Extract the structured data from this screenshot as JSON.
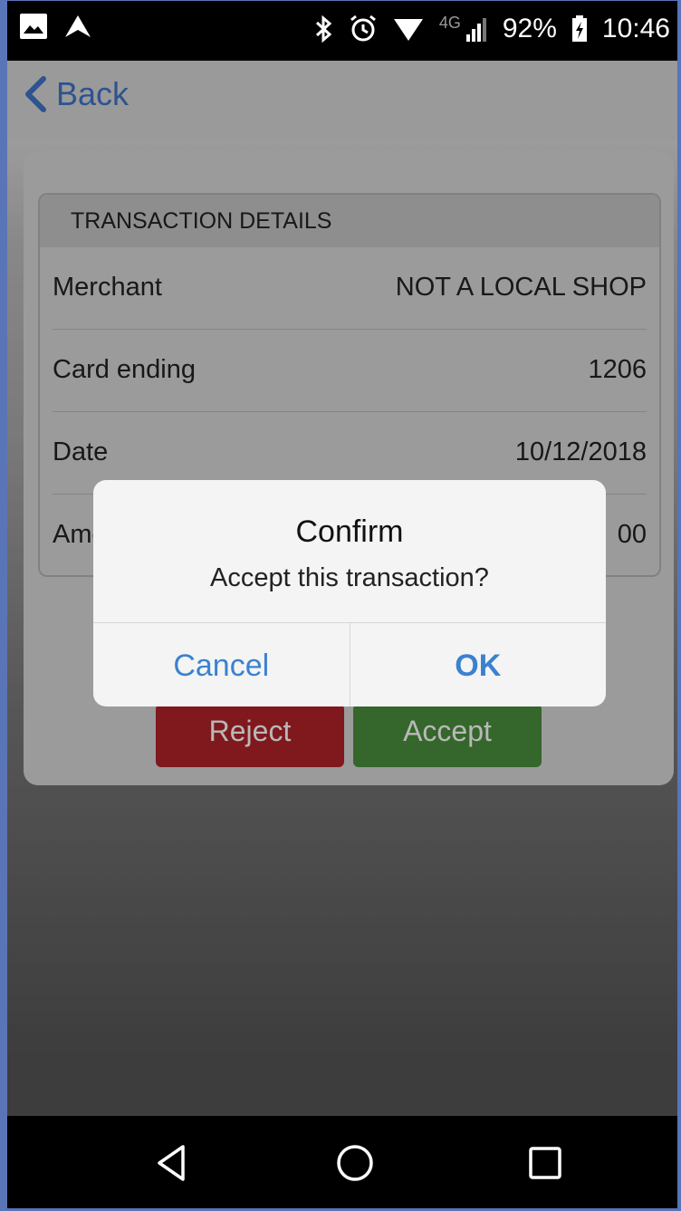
{
  "status_bar": {
    "battery": "92%",
    "time": "10:46",
    "network": "4G"
  },
  "header": {
    "back_label": "Back"
  },
  "details": {
    "title": "TRANSACTION DETAILS",
    "rows": [
      {
        "label": "Merchant",
        "value": "NOT A LOCAL SHOP"
      },
      {
        "label": "Card ending",
        "value": "1206"
      },
      {
        "label": "Date",
        "value": "10/12/2018"
      },
      {
        "label": "Amount",
        "value": "00"
      }
    ]
  },
  "actions": {
    "reject": "Reject",
    "accept": "Accept"
  },
  "dialog": {
    "title": "Confirm",
    "message": "Accept this transaction?",
    "cancel": "Cancel",
    "ok": "OK"
  },
  "colors": {
    "accent": "#3f73c8",
    "reject": "#b0232a",
    "accept": "#4a8e3c"
  }
}
